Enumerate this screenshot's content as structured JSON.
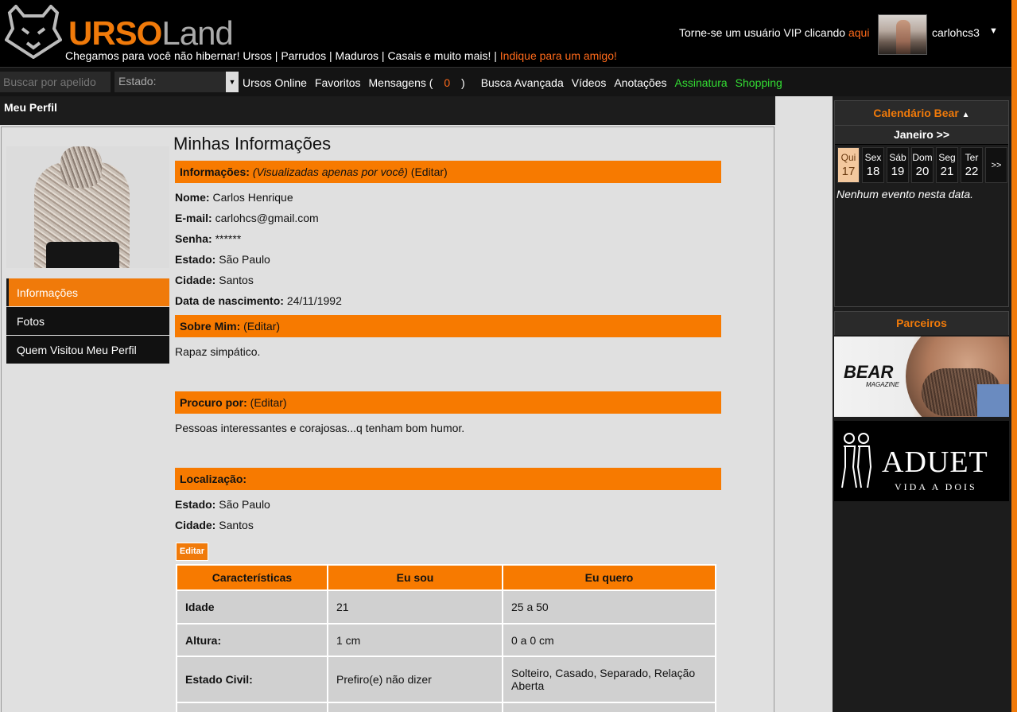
{
  "header": {
    "logo_part1": "URSO",
    "logo_part2": "Land",
    "tagline": "Chegamos para você não hibernar! Ursos | Parrudos | Maduros | Casais e muito mais! |",
    "tagline_link": "Indique para um amigo!",
    "vip_text": "Torne-se um usuário VIP clicando",
    "vip_link": "aqui",
    "username": "carlohcs3",
    "user_caret": "▼"
  },
  "nav": {
    "search_placeholder": "Buscar por apelido",
    "estado_label": "Estado:",
    "estado_caret": "▼",
    "links": {
      "ursos_online": "Ursos Online",
      "favoritos": "Favoritos",
      "mensagens": "Mensagens (",
      "mensagens_count": "0",
      "mensagens_close": ")",
      "busca": "Busca Avançada",
      "videos": "Vídeos",
      "anotacoes": "Anotações",
      "assinatura": "Assinatura",
      "shopping": "Shopping"
    }
  },
  "main": {
    "title": "Meu Perfil",
    "heading": "Minhas Informações",
    "side_menu": [
      "Informações",
      "Fotos",
      "Quem Visitou Meu Perfil"
    ],
    "info_bar": {
      "label": "Informações:",
      "note": "(Visualizadas apenas por você)",
      "edit": "(Editar)"
    },
    "info": {
      "nome_label": "Nome:",
      "nome": "Carlos Henrique",
      "email_label": "E-mail:",
      "email": "carlohcs@gmail.com",
      "senha_label": "Senha:",
      "senha": "******",
      "estado_label": "Estado:",
      "estado": "São Paulo",
      "cidade_label": "Cidade:",
      "cidade": "Santos",
      "nasc_label": "Data de nascimento:",
      "nasc": "24/11/1992"
    },
    "sobre_bar": {
      "label": "Sobre Mim:",
      "edit": "(Editar)"
    },
    "sobre_text": "Rapaz simpático.",
    "procuro_bar": {
      "label": "Procuro por:",
      "edit": "(Editar)"
    },
    "procuro_text": "Pessoas interessantes e corajosas...q tenham bom humor.",
    "local_bar": {
      "label": "Localização:"
    },
    "local": {
      "estado_label": "Estado:",
      "estado": "São Paulo",
      "cidade_label": "Cidade:",
      "cidade": "Santos"
    },
    "edit_button": "Editar",
    "table": {
      "headers": [
        "Características",
        "Eu sou",
        "Eu quero"
      ],
      "rows": [
        {
          "label": "Idade",
          "sou": "21",
          "quero": "25 a 50"
        },
        {
          "label": "Altura:",
          "sou": "1 cm",
          "quero": "0 a 0 cm"
        },
        {
          "label": "Estado Civil:",
          "sou": "Prefiro(e) não dizer",
          "quero": "Solteiro, Casado, Separado, Relação Aberta"
        }
      ]
    }
  },
  "sidebar": {
    "calendar_title": "Calendário Bear",
    "calendar_caret": "▲",
    "month": "Janeiro >>",
    "days": [
      {
        "name": "Qui",
        "num": "17"
      },
      {
        "name": "Sex",
        "num": "18"
      },
      {
        "name": "Sáb",
        "num": "19"
      },
      {
        "name": "Dom",
        "num": "20"
      },
      {
        "name": "Seg",
        "num": "21"
      },
      {
        "name": "Ter",
        "num": "22"
      }
    ],
    "next": ">>",
    "no_event": "Nenhum evento nesta data.",
    "partners_title": "Parceiros",
    "ad1_logo": "BEAR",
    "ad1_sub": "MAGAZINE",
    "ad2_title": "ADUET",
    "ad2_sub": "VIDA A DOIS"
  },
  "colors": {
    "accent": "#f07a0a",
    "bar_orange": "#f77a00",
    "green_link": "#33dd33"
  }
}
